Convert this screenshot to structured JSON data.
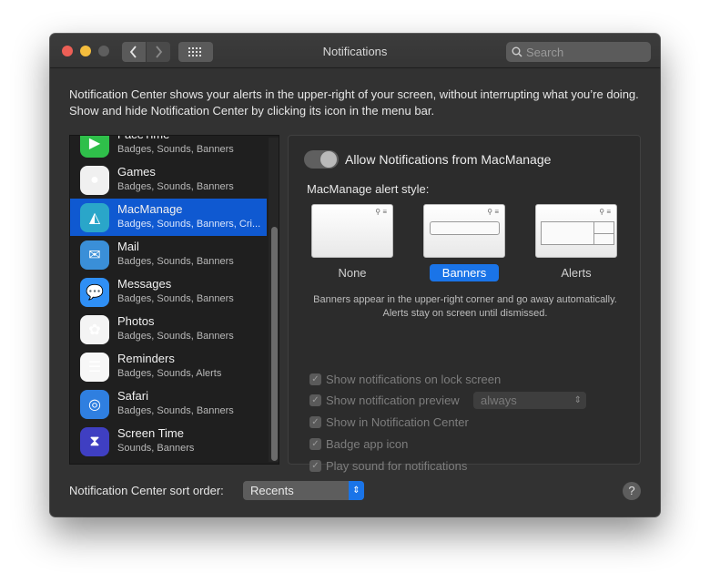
{
  "window": {
    "title": "Notifications",
    "search_placeholder": "Search"
  },
  "intro_text": "Notification Center shows your alerts in the upper-right of your screen, without interrupting what you’re doing. Show and hide Notification Center by clicking its icon in the menu bar.",
  "apps": [
    {
      "name": "FaceTime",
      "sub": "Badges, Sounds, Banners",
      "icon": "facetime-icon",
      "color": "#2fbf4a",
      "glyph": "▶"
    },
    {
      "name": "Games",
      "sub": "Badges, Sounds, Banners",
      "icon": "games-icon",
      "color": "#f0f0f0",
      "glyph": "●"
    },
    {
      "name": "MacManage",
      "sub": "Badges, Sounds, Banners, Cri...",
      "icon": "macmanage-icon",
      "color": "#2aa6c9",
      "glyph": "◭",
      "selected": true
    },
    {
      "name": "Mail",
      "sub": "Badges, Sounds, Banners",
      "icon": "mail-icon",
      "color": "#3a8fd8",
      "glyph": "✉"
    },
    {
      "name": "Messages",
      "sub": "Badges, Sounds, Banners",
      "icon": "messages-icon",
      "color": "#2f8ff5",
      "glyph": "💬"
    },
    {
      "name": "Photos",
      "sub": "Badges, Sounds, Banners",
      "icon": "photos-icon",
      "color": "#f4f4f4",
      "glyph": "✿"
    },
    {
      "name": "Reminders",
      "sub": "Badges, Sounds, Alerts",
      "icon": "reminders-icon",
      "color": "#f7f7f7",
      "glyph": "☰"
    },
    {
      "name": "Safari",
      "sub": "Badges, Sounds, Banners",
      "icon": "safari-icon",
      "color": "#2f7fe0",
      "glyph": "◎"
    },
    {
      "name": "Screen Time",
      "sub": "Sounds, Banners",
      "icon": "screen-time-icon",
      "color": "#3f3fc2",
      "glyph": "⧗"
    }
  ],
  "detail": {
    "allow_label": "Allow Notifications from MacManage",
    "allow_enabled": false,
    "style_label": "MacManage alert style:",
    "styles": [
      "None",
      "Banners",
      "Alerts"
    ],
    "selected_style": "Banners",
    "help_text": "Banners appear in the upper-right corner and go away automatically. Alerts stay on screen until dismissed.",
    "options": [
      {
        "label": "Show notifications on lock screen",
        "checked": true
      },
      {
        "label": "Show notification preview",
        "checked": true
      },
      {
        "label": "Show in Notification Center",
        "checked": true
      },
      {
        "label": "Badge app icon",
        "checked": true
      },
      {
        "label": "Play sound for notifications",
        "checked": true
      }
    ],
    "preview_select": "always"
  },
  "sort": {
    "label": "Notification Center sort order:",
    "value": "Recents"
  },
  "help_glyph": "?"
}
